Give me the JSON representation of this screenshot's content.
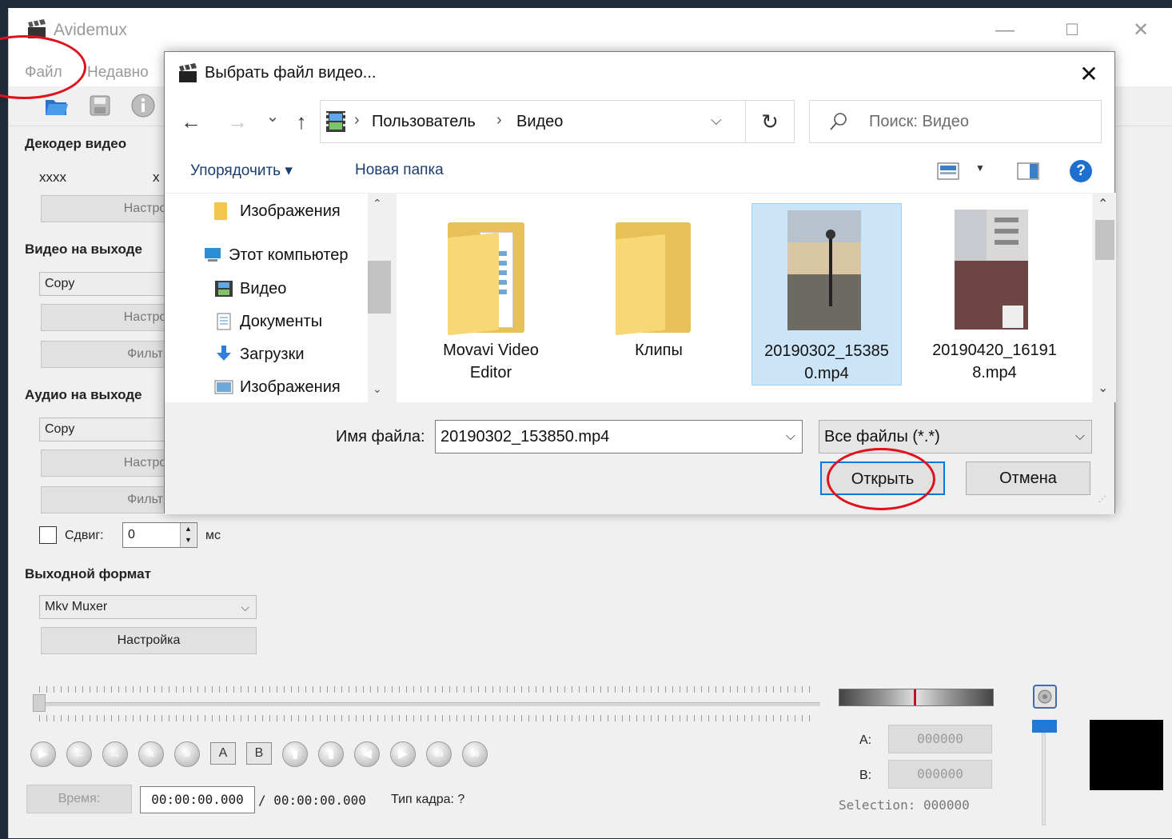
{
  "app": {
    "title": "Avidemux",
    "menu": [
      "Файл",
      "Недавно"
    ],
    "controls": {
      "minimize": "—",
      "maximize": "☐",
      "close": "✕"
    }
  },
  "sidebar": {
    "video_decoder": {
      "title": "Декодер видео",
      "value1": "xxxx",
      "value2": "x",
      "configure": "Настрой"
    },
    "video_output": {
      "title": "Видео на выходе",
      "codec": "Copy",
      "configure": "Настрой",
      "filters": "Фильтр"
    },
    "audio_output": {
      "title": "Аудио на выходе",
      "codec": "Copy",
      "configure": "Настрой",
      "filters": "Фильтр"
    },
    "shift": {
      "label": "Сдвиг:",
      "value": "0",
      "unit": "мс",
      "checked": false
    },
    "output_format": {
      "title": "Выходной формат",
      "muxer": "Mkv Muxer",
      "configure": "Настройка"
    }
  },
  "playback": {
    "time_button": "Время:",
    "current_time": "00:00:00.000",
    "total_time": "/ 00:00:00.000",
    "frame_type": "Тип кадра:  ?",
    "marker_a_label": "A:",
    "marker_a": "000000",
    "marker_b_label": "B:",
    "marker_b": "000000",
    "selection": "Selection: 000000",
    "buttons": [
      "play-icon",
      "prev-frame-icon",
      "next-frame-icon",
      "rewind-icon",
      "fast-forward-icon",
      "marker-a-icon",
      "marker-b-icon",
      "goto-a-icon",
      "goto-b-icon",
      "prev-keyframe-icon",
      "next-keyframe-icon",
      "back-60-icon",
      "forward-60-icon"
    ],
    "marker_a_btn": "A",
    "marker_b_btn": "B"
  },
  "dialog": {
    "title": "Выбрать файл видео...",
    "close": "✕",
    "nav": {
      "back": "←",
      "forward": "→",
      "recent": "⌄",
      "up": "↑",
      "refresh": "↻"
    },
    "breadcrumb": [
      "Пользователь",
      "Видео"
    ],
    "search_placeholder": "Поиск: Видео",
    "toolbar": {
      "organize": "Упорядочить ▾",
      "new_folder": "Новая папка",
      "help": "?"
    },
    "nav_pane": [
      "Изображения",
      "Этот компьютер",
      "Видео",
      "Документы",
      "Загрузки",
      "Изображения"
    ],
    "files": [
      {
        "name_line1": "Movavi Video",
        "name_line2": "Editor",
        "kind": "folder"
      },
      {
        "name_line1": "Клипы",
        "name_line2": "",
        "kind": "folder"
      },
      {
        "name_line1": "20190302_15385",
        "name_line2": "0.mp4",
        "kind": "video",
        "selected": true
      },
      {
        "name_line1": "20190420_16191",
        "name_line2": "8.mp4",
        "kind": "video"
      }
    ],
    "filename_label": "Имя файла:",
    "filename_value": "20190302_153850.mp4",
    "filetype_value": "Все файлы (*.*)",
    "open_button": "Открыть",
    "cancel_button": "Отмена"
  },
  "colors": {
    "accent": "#0078d7",
    "selection": "#cce4f7",
    "annotation": "#e0101c"
  }
}
